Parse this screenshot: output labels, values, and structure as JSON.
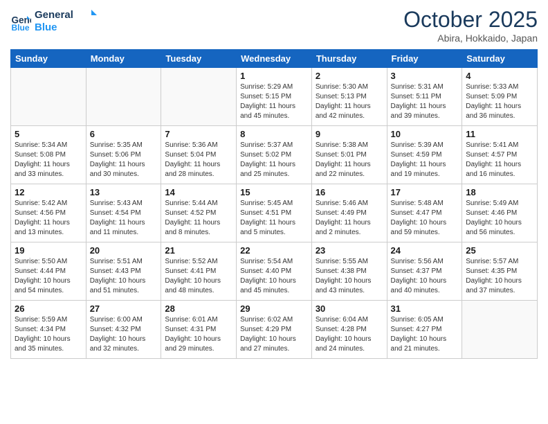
{
  "header": {
    "logo_line1": "General",
    "logo_line2": "Blue",
    "month": "October 2025",
    "location": "Abira, Hokkaido, Japan"
  },
  "days_of_week": [
    "Sunday",
    "Monday",
    "Tuesday",
    "Wednesday",
    "Thursday",
    "Friday",
    "Saturday"
  ],
  "weeks": [
    [
      {
        "day": "",
        "info": ""
      },
      {
        "day": "",
        "info": ""
      },
      {
        "day": "",
        "info": ""
      },
      {
        "day": "1",
        "info": "Sunrise: 5:29 AM\nSunset: 5:15 PM\nDaylight: 11 hours\nand 45 minutes."
      },
      {
        "day": "2",
        "info": "Sunrise: 5:30 AM\nSunset: 5:13 PM\nDaylight: 11 hours\nand 42 minutes."
      },
      {
        "day": "3",
        "info": "Sunrise: 5:31 AM\nSunset: 5:11 PM\nDaylight: 11 hours\nand 39 minutes."
      },
      {
        "day": "4",
        "info": "Sunrise: 5:33 AM\nSunset: 5:09 PM\nDaylight: 11 hours\nand 36 minutes."
      }
    ],
    [
      {
        "day": "5",
        "info": "Sunrise: 5:34 AM\nSunset: 5:08 PM\nDaylight: 11 hours\nand 33 minutes."
      },
      {
        "day": "6",
        "info": "Sunrise: 5:35 AM\nSunset: 5:06 PM\nDaylight: 11 hours\nand 30 minutes."
      },
      {
        "day": "7",
        "info": "Sunrise: 5:36 AM\nSunset: 5:04 PM\nDaylight: 11 hours\nand 28 minutes."
      },
      {
        "day": "8",
        "info": "Sunrise: 5:37 AM\nSunset: 5:02 PM\nDaylight: 11 hours\nand 25 minutes."
      },
      {
        "day": "9",
        "info": "Sunrise: 5:38 AM\nSunset: 5:01 PM\nDaylight: 11 hours\nand 22 minutes."
      },
      {
        "day": "10",
        "info": "Sunrise: 5:39 AM\nSunset: 4:59 PM\nDaylight: 11 hours\nand 19 minutes."
      },
      {
        "day": "11",
        "info": "Sunrise: 5:41 AM\nSunset: 4:57 PM\nDaylight: 11 hours\nand 16 minutes."
      }
    ],
    [
      {
        "day": "12",
        "info": "Sunrise: 5:42 AM\nSunset: 4:56 PM\nDaylight: 11 hours\nand 13 minutes."
      },
      {
        "day": "13",
        "info": "Sunrise: 5:43 AM\nSunset: 4:54 PM\nDaylight: 11 hours\nand 11 minutes."
      },
      {
        "day": "14",
        "info": "Sunrise: 5:44 AM\nSunset: 4:52 PM\nDaylight: 11 hours\nand 8 minutes."
      },
      {
        "day": "15",
        "info": "Sunrise: 5:45 AM\nSunset: 4:51 PM\nDaylight: 11 hours\nand 5 minutes."
      },
      {
        "day": "16",
        "info": "Sunrise: 5:46 AM\nSunset: 4:49 PM\nDaylight: 11 hours\nand 2 minutes."
      },
      {
        "day": "17",
        "info": "Sunrise: 5:48 AM\nSunset: 4:47 PM\nDaylight: 10 hours\nand 59 minutes."
      },
      {
        "day": "18",
        "info": "Sunrise: 5:49 AM\nSunset: 4:46 PM\nDaylight: 10 hours\nand 56 minutes."
      }
    ],
    [
      {
        "day": "19",
        "info": "Sunrise: 5:50 AM\nSunset: 4:44 PM\nDaylight: 10 hours\nand 54 minutes."
      },
      {
        "day": "20",
        "info": "Sunrise: 5:51 AM\nSunset: 4:43 PM\nDaylight: 10 hours\nand 51 minutes."
      },
      {
        "day": "21",
        "info": "Sunrise: 5:52 AM\nSunset: 4:41 PM\nDaylight: 10 hours\nand 48 minutes."
      },
      {
        "day": "22",
        "info": "Sunrise: 5:54 AM\nSunset: 4:40 PM\nDaylight: 10 hours\nand 45 minutes."
      },
      {
        "day": "23",
        "info": "Sunrise: 5:55 AM\nSunset: 4:38 PM\nDaylight: 10 hours\nand 43 minutes."
      },
      {
        "day": "24",
        "info": "Sunrise: 5:56 AM\nSunset: 4:37 PM\nDaylight: 10 hours\nand 40 minutes."
      },
      {
        "day": "25",
        "info": "Sunrise: 5:57 AM\nSunset: 4:35 PM\nDaylight: 10 hours\nand 37 minutes."
      }
    ],
    [
      {
        "day": "26",
        "info": "Sunrise: 5:59 AM\nSunset: 4:34 PM\nDaylight: 10 hours\nand 35 minutes."
      },
      {
        "day": "27",
        "info": "Sunrise: 6:00 AM\nSunset: 4:32 PM\nDaylight: 10 hours\nand 32 minutes."
      },
      {
        "day": "28",
        "info": "Sunrise: 6:01 AM\nSunset: 4:31 PM\nDaylight: 10 hours\nand 29 minutes."
      },
      {
        "day": "29",
        "info": "Sunrise: 6:02 AM\nSunset: 4:29 PM\nDaylight: 10 hours\nand 27 minutes."
      },
      {
        "day": "30",
        "info": "Sunrise: 6:04 AM\nSunset: 4:28 PM\nDaylight: 10 hours\nand 24 minutes."
      },
      {
        "day": "31",
        "info": "Sunrise: 6:05 AM\nSunset: 4:27 PM\nDaylight: 10 hours\nand 21 minutes."
      },
      {
        "day": "",
        "info": ""
      }
    ]
  ]
}
